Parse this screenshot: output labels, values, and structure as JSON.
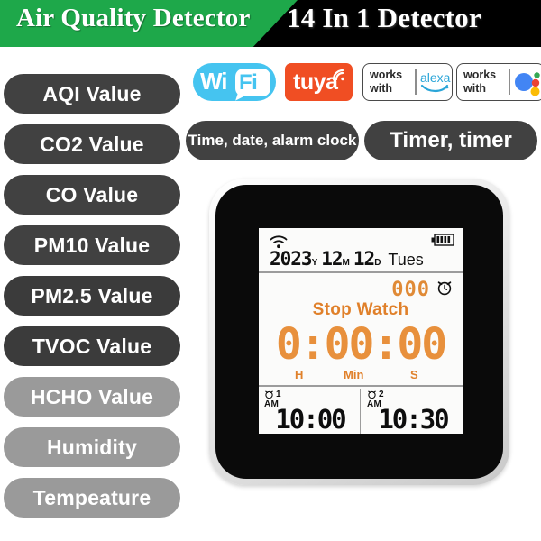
{
  "header": {
    "title_left": "Air Quality Detector",
    "title_right": "14 In 1 Detector",
    "green_color": "#1ea84a",
    "black_color": "#000000"
  },
  "feature_pills": [
    {
      "label": "AQI Value",
      "tone": "dark"
    },
    {
      "label": "CO2 Value",
      "tone": "dark"
    },
    {
      "label": "CO Value",
      "tone": "dark"
    },
    {
      "label": "PM10 Value",
      "tone": "dark"
    },
    {
      "label": "PM2.5 Value",
      "tone": "mid"
    },
    {
      "label": "TVOC Value",
      "tone": "mid"
    },
    {
      "label": "HCHO Value",
      "tone": "light"
    },
    {
      "label": "Humidity",
      "tone": "light"
    },
    {
      "label": "Tempeature",
      "tone": "light"
    }
  ],
  "badges": {
    "wifi": {
      "text_a": "Wi",
      "text_b": "Fi",
      "color": "#45c4f0"
    },
    "tuya": {
      "label": "tuya",
      "color": "#f04e23"
    },
    "alexa": {
      "works_line1": "works",
      "works_line2": "with",
      "brand": "alexa",
      "brand_color": "#2aa5d8"
    },
    "google": {
      "works_line1": "works",
      "works_line2": "with",
      "dot_blue": "#4285f4",
      "dot_red": "#ea4335",
      "dot_yellow": "#fbbc05",
      "dot_green": "#34a853"
    }
  },
  "row_pills": [
    {
      "label": "Time, date, alarm clock",
      "font_size": "17px"
    },
    {
      "label": "Timer, timer",
      "font_size": "24px"
    }
  ],
  "device": {
    "lcd": {
      "wifi_icon": "wifi-icon",
      "battery_icon": "battery-icon",
      "date": {
        "year": "2023",
        "year_unit": "Y",
        "month": "12",
        "month_unit": "M",
        "day": "12",
        "day_unit": "D",
        "weekday": "Tues"
      },
      "stopwatch": {
        "count": "000",
        "alarm_icon": "alarm-clock-icon",
        "title": "Stop Watch",
        "time": "0:00:00",
        "unit_h": "H",
        "unit_min": "Min",
        "unit_s": "S",
        "accent_color": "#e8903c"
      },
      "alarms": [
        {
          "index": "1",
          "ampm": "AM",
          "time": "10:00",
          "icon": "alarm-clock-icon"
        },
        {
          "index": "2",
          "ampm": "AM",
          "time": "10:30",
          "icon": "alarm-clock-icon"
        }
      ]
    }
  }
}
